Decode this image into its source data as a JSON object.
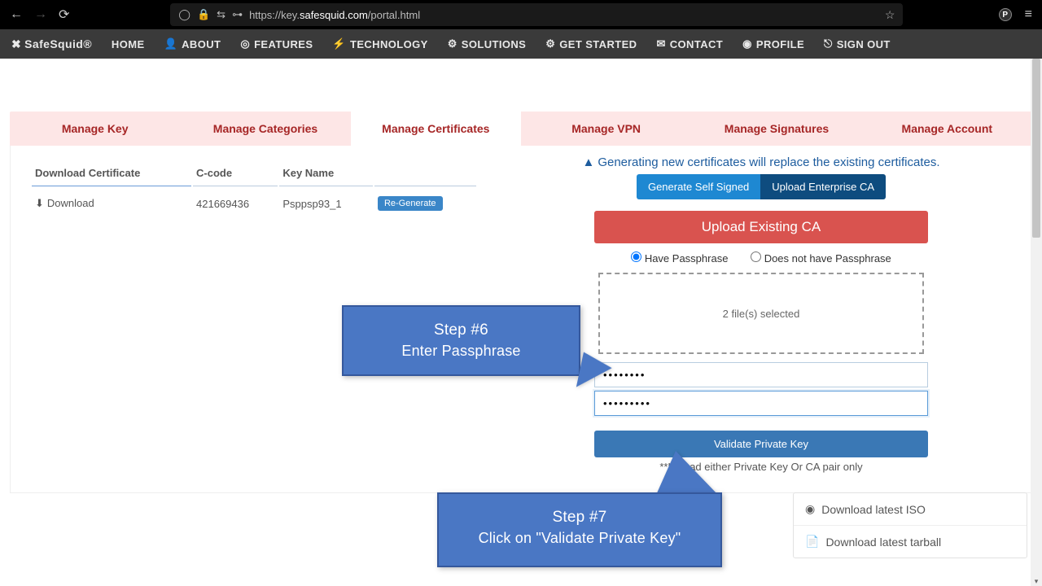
{
  "browser": {
    "url_prefix": "https://key.",
    "url_host": "safesquid.com",
    "url_path": "/portal.html",
    "avatar_letter": "P"
  },
  "brand": "SafeSquid®",
  "nav": {
    "home": "HOME",
    "about": "ABOUT",
    "features": "FEATURES",
    "technology": "TECHNOLOGY",
    "solutions": "SOLUTIONS",
    "getstarted": "GET STARTED",
    "contact": "CONTACT",
    "profile": "PROFILE",
    "signout": "SIGN OUT"
  },
  "tabs": {
    "key": "Manage Key",
    "categories": "Manage Categories",
    "certificates": "Manage Certificates",
    "vpn": "Manage VPN",
    "signatures": "Manage Signatures",
    "account": "Manage Account"
  },
  "table": {
    "hdr_download": "Download Certificate",
    "hdr_ccode": "C-code",
    "hdr_keyname": "Key Name",
    "row": {
      "download": "Download",
      "ccode": "421669436",
      "keyname": "Psppsp93_1",
      "regen": "Re-Generate"
    }
  },
  "panel": {
    "warn": "Generating new certificates will replace the existing certificates.",
    "gen_self": "Generate Self Signed",
    "upload_ent": "Upload Enterprise CA",
    "upload_existing": "Upload Existing CA",
    "have_pass": "Have Passphrase",
    "no_pass": "Does not have Passphrase",
    "files_selected": "2 file(s) selected",
    "pass1": "••••••••",
    "pass2": "•••••••••",
    "validate": "Validate Private Key",
    "note": "**Upload either Private Key Or CA pair only"
  },
  "sidebox": {
    "iso": "Download latest ISO",
    "tarball": "Download latest tarball"
  },
  "callouts": {
    "c6_line1": "Step #6",
    "c6_line2": "Enter Passphrase",
    "c7_line1": "Step #7",
    "c7_line2": "Click on \"Validate Private Key\""
  }
}
